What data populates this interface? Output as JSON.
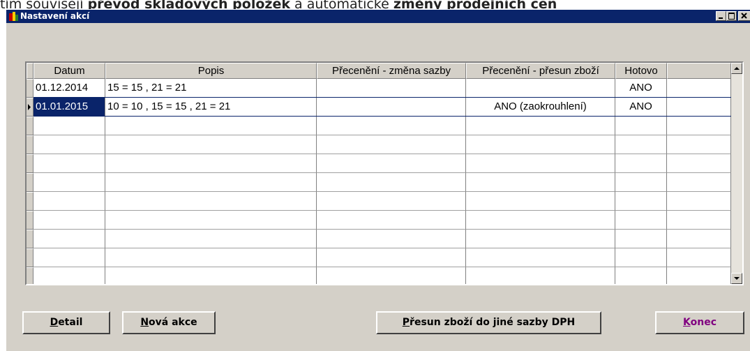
{
  "doc_snippet": {
    "prefix": "tím souvisejí",
    "bold1": "převod skladových položek",
    "middle": "a automatické",
    "bold2": "změny prodejních cen"
  },
  "window": {
    "title": "Nastavení akcí",
    "titlebar_color": "#0a246a"
  },
  "grid": {
    "columns": [
      "Datum",
      "Popis",
      "Přecenění - změna sazby",
      "Přecenění - přesun zboží",
      "Hotovo",
      ""
    ],
    "rows": [
      {
        "datum": "01.12.2014",
        "popis": "15 = 15 , 21 = 21",
        "zmena_sazby": "",
        "presun_zbozi": "",
        "hotovo": "ANO"
      },
      {
        "datum": "01.01.2015",
        "popis": "10 = 10 , 15 = 15 , 21 = 21",
        "zmena_sazby": "",
        "presun_zbozi": "ANO (zaokrouhlení)",
        "hotovo": "ANO"
      }
    ],
    "selected_row": 1,
    "selection_color": "#0a246a"
  },
  "buttons": {
    "detail": {
      "accel": "D",
      "rest": "etail"
    },
    "nova_akce": {
      "accel": "N",
      "rest": "ová akce"
    },
    "presun": {
      "accel": "P",
      "rest": "řesun zboží do jiné sazby DPH"
    },
    "konec": {
      "accel": "K",
      "rest": "onec",
      "color": "#800080"
    }
  },
  "icons": [
    "app-icon",
    "minimize-icon",
    "maximize-icon",
    "close-icon",
    "row-pointer-icon",
    "scroll-up-icon",
    "scroll-down-icon"
  ]
}
